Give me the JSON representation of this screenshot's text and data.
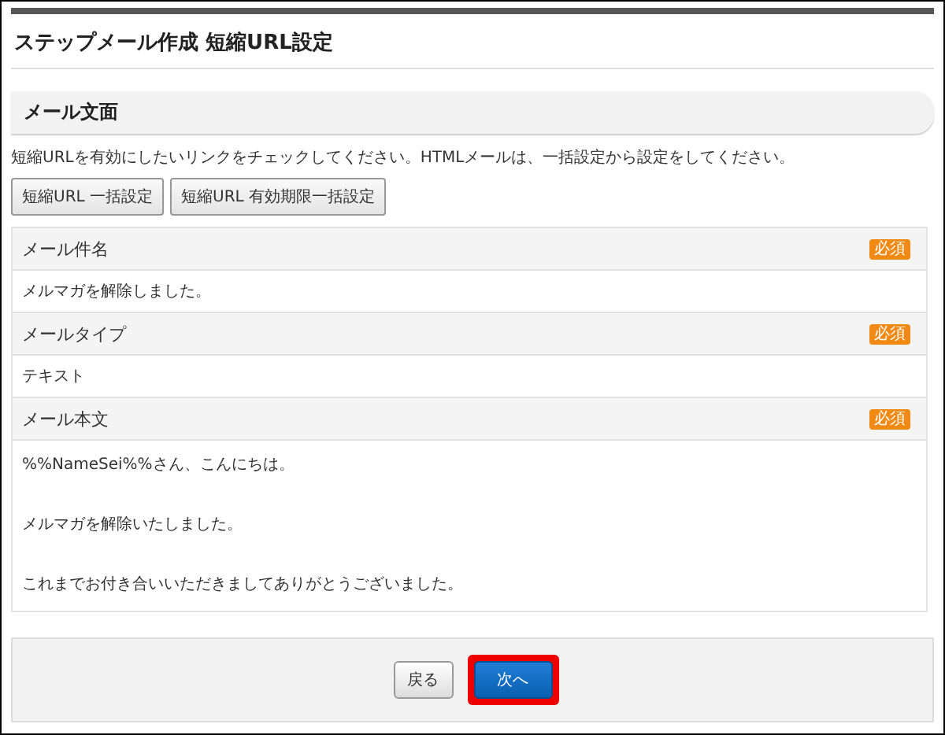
{
  "page_title": "ステップメール作成 短縮URL設定",
  "section": {
    "title": "メール文面",
    "description": "短縮URLを有効にしたいリンクをチェックしてください。HTMLメールは、一括設定から設定をしてください。",
    "buttons": [
      "短縮URL 一括設定",
      "短縮URL 有効期限一括設定"
    ]
  },
  "fields": [
    {
      "label": "メール件名",
      "badge": "必須",
      "lines": [
        "メルマガを解除しました。"
      ]
    },
    {
      "label": "メールタイプ",
      "badge": "必須",
      "lines": [
        "テキスト"
      ]
    },
    {
      "label": "メール本文",
      "badge": "必須",
      "lines": [
        "%%NameSei%%さん、こんにちは。",
        "メルマガを解除いたしました。",
        "これまでお付き合いいただきましてありがとうございました。"
      ]
    }
  ],
  "footer_buttons": [
    {
      "label": "戻る",
      "kind": "secondary",
      "highlighted": false
    },
    {
      "label": "次へ",
      "kind": "primary",
      "highlighted": true
    }
  ]
}
